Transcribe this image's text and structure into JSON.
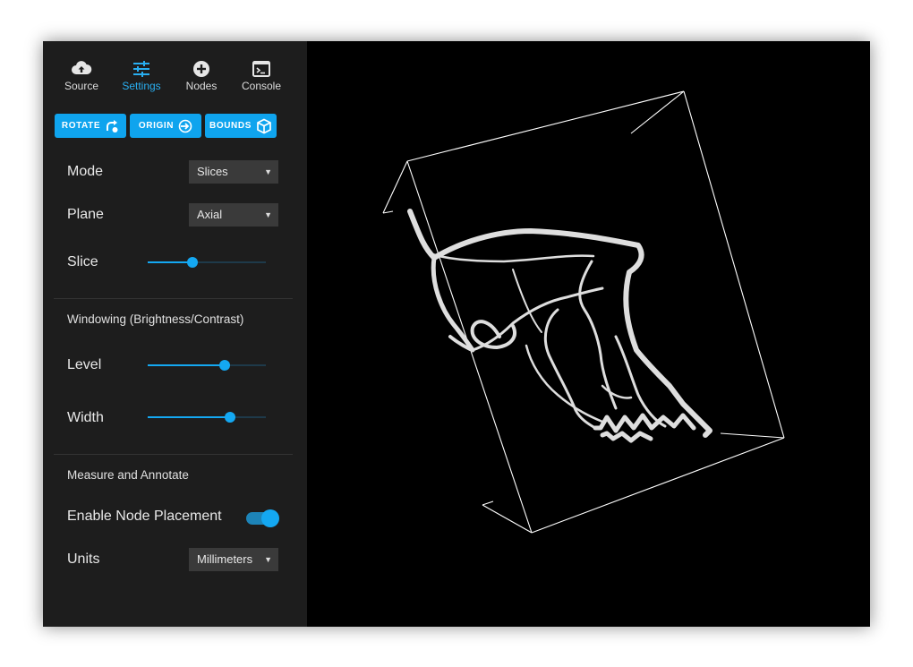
{
  "tabs": [
    {
      "label": "Source",
      "icon": "cloud-upload-icon"
    },
    {
      "label": "Settings",
      "icon": "sliders-icon",
      "active": true
    },
    {
      "label": "Nodes",
      "icon": "plus-circle-icon"
    },
    {
      "label": "Console",
      "icon": "terminal-icon"
    }
  ],
  "toolbar": {
    "rotate_label": "ROTATE",
    "origin_label": "ORIGIN",
    "bounds_label": "BOUNDS"
  },
  "settings": {
    "mode": {
      "label": "Mode",
      "value": "Slices"
    },
    "plane": {
      "label": "Plane",
      "value": "Axial"
    },
    "slice": {
      "label": "Slice",
      "value_fraction": 0.38
    }
  },
  "windowing": {
    "title": "Windowing (Brightness/Contrast)",
    "level": {
      "label": "Level",
      "value_fraction": 0.65
    },
    "width": {
      "label": "Width",
      "value_fraction": 0.7
    }
  },
  "measure": {
    "title": "Measure and Annotate",
    "node_placement": {
      "label": "Enable Node Placement",
      "enabled": true
    },
    "units": {
      "label": "Units",
      "value": "Millimeters"
    }
  },
  "colors": {
    "accent": "#0fa4ee",
    "sidebar_bg": "#1d1d1d",
    "viewer_bg": "#000000"
  }
}
